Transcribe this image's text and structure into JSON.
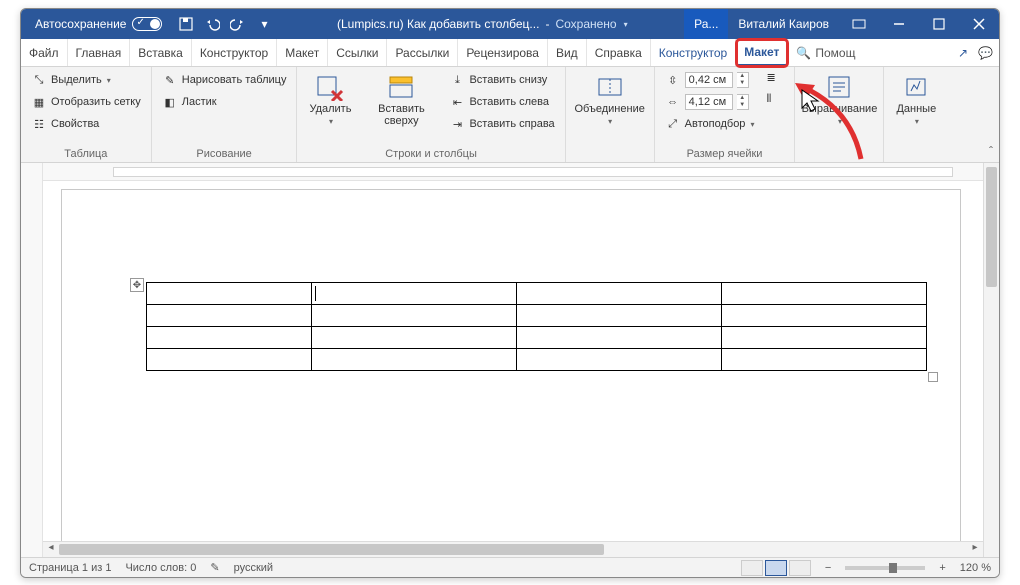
{
  "titlebar": {
    "autosave_label": "Автосохранение",
    "doc_title": "(Lumpics.ru) Как добавить столбец...",
    "saved_label": "Сохранено",
    "account_short": "Ра...",
    "user_name": "Виталий Каиров"
  },
  "tabs": {
    "file": "Файл",
    "home": "Главная",
    "insert": "Вставка",
    "design": "Конструктор",
    "layout": "Макет",
    "references": "Ссылки",
    "mailings": "Рассылки",
    "review": "Рецензирова",
    "view": "Вид",
    "help": "Справка",
    "table_design": "Конструктор",
    "table_layout": "Макет",
    "tell_me": "Помощ"
  },
  "ribbon": {
    "group_table": "Таблица",
    "select": "Выделить",
    "show_grid": "Отобразить сетку",
    "properties": "Свойства",
    "group_draw": "Рисование",
    "draw_table": "Нарисовать таблицу",
    "eraser": "Ластик",
    "delete": "Удалить",
    "insert_above": "Вставить сверху",
    "insert_below": "Вставить снизу",
    "insert_left": "Вставить слева",
    "insert_right": "Вставить справа",
    "group_rows_cols": "Строки и столбцы",
    "merge": "Объединение",
    "row_height": "0,42 см",
    "col_width": "4,12 см",
    "autofit": "Автоподбор",
    "group_cell_size": "Размер ячейки",
    "alignment": "Выравнивание",
    "data": "Данные"
  },
  "document": {
    "table_cols": [
      165,
      205,
      205,
      205
    ],
    "table_rows": 4
  },
  "statusbar": {
    "page": "Страница 1 из 1",
    "words": "Число слов: 0",
    "language": "русский",
    "zoom": "120 %"
  }
}
